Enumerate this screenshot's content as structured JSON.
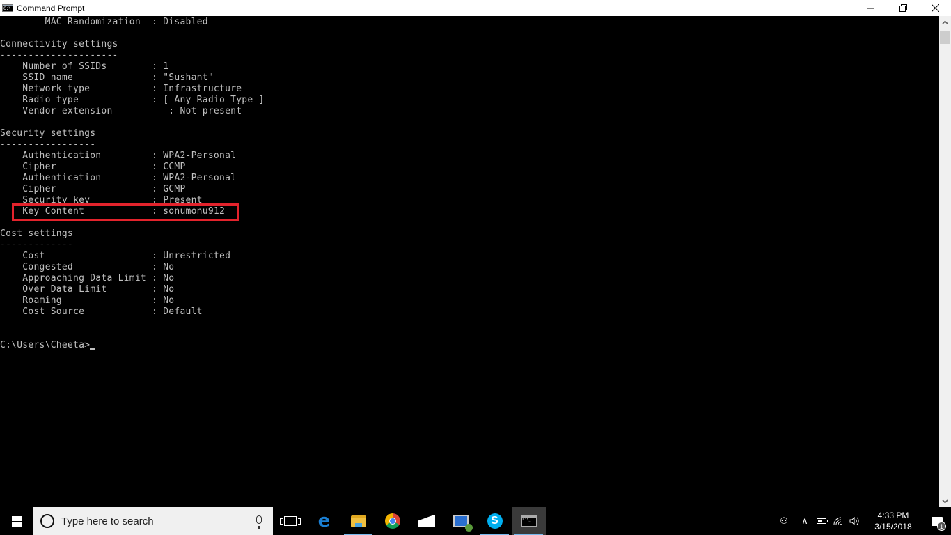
{
  "window": {
    "title": "Command Prompt",
    "minimize_icon": "minimize-icon",
    "maximize_icon": "restore-icon",
    "close_icon": "close-icon"
  },
  "console": {
    "lines": [
      "        MAC Randomization  : Disabled",
      "",
      "Connectivity settings",
      "---------------------",
      "    Number of SSIDs        : 1",
      "    SSID name              : \"Sushant\"",
      "    Network type           : Infrastructure",
      "    Radio type             : [ Any Radio Type ]",
      "    Vendor extension          : Not present",
      "",
      "Security settings",
      "-----------------",
      "    Authentication         : WPA2-Personal",
      "    Cipher                 : CCMP",
      "    Authentication         : WPA2-Personal",
      "    Cipher                 : GCMP",
      "    Security key           : Present",
      "    Key Content            : sonumonu912",
      "",
      "Cost settings",
      "-------------",
      "    Cost                   : Unrestricted",
      "    Congested              : No",
      "    Approaching Data Limit : No",
      "    Over Data Limit        : No",
      "    Roaming                : No",
      "    Cost Source            : Default",
      "",
      "",
      "C:\\Users\\Cheeta>"
    ],
    "highlight_color": "#e3232c",
    "highlighted_line": "Key Content"
  },
  "taskbar": {
    "search_placeholder": "Type here to search",
    "apps": [
      {
        "name": "Task View",
        "icon": "task-view-icon"
      },
      {
        "name": "Microsoft Edge",
        "icon": "edge-icon"
      },
      {
        "name": "File Explorer",
        "icon": "folder-icon"
      },
      {
        "name": "Google Chrome",
        "icon": "chrome-icon"
      },
      {
        "name": "Mail",
        "icon": "mail-icon"
      },
      {
        "name": "Remote Desktop",
        "icon": "remote-desktop-icon"
      },
      {
        "name": "Skype",
        "icon": "skype-icon",
        "glyph": "S"
      },
      {
        "name": "Command Prompt",
        "icon": "cmd-icon",
        "glyph": "C:\\_"
      }
    ],
    "tray": {
      "people_glyph": "⚇",
      "chevron_glyph": "∧",
      "wifi_glyph": "◠",
      "volume_glyph": "🔊",
      "time": "4:33 PM",
      "date": "3/15/2018",
      "notification_count": "1"
    }
  }
}
